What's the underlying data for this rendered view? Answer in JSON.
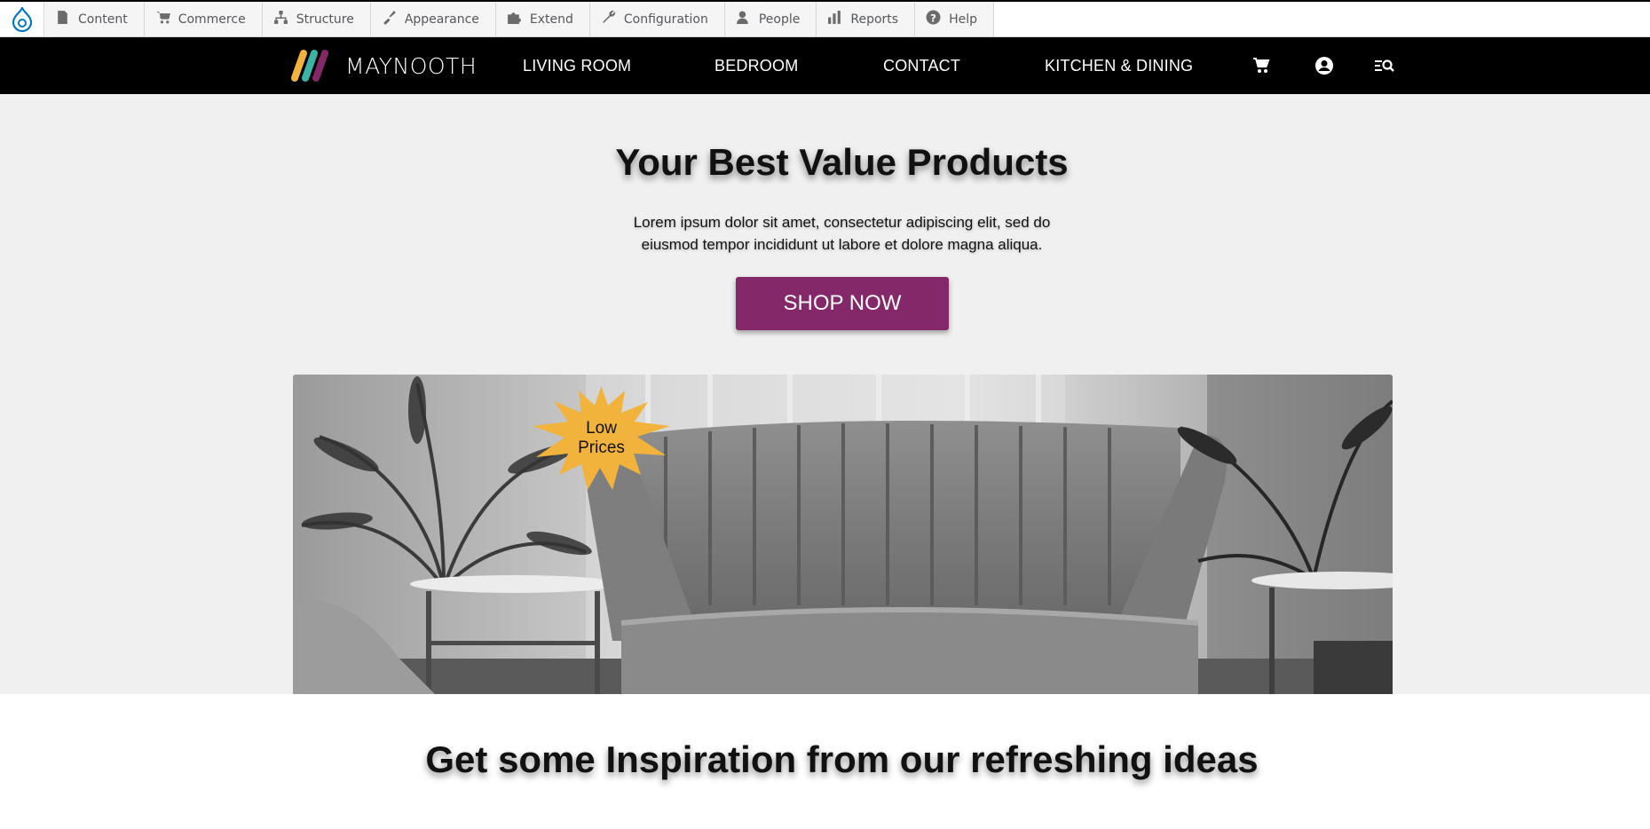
{
  "admin_toolbar": {
    "items": [
      {
        "label": "Content",
        "icon": "document-icon"
      },
      {
        "label": "Commerce",
        "icon": "cart-icon"
      },
      {
        "label": "Structure",
        "icon": "sitemap-icon"
      },
      {
        "label": "Appearance",
        "icon": "paintbrush-icon"
      },
      {
        "label": "Extend",
        "icon": "puzzle-icon"
      },
      {
        "label": "Configuration",
        "icon": "wrench-icon"
      },
      {
        "label": "People",
        "icon": "person-icon"
      },
      {
        "label": "Reports",
        "icon": "bar-chart-icon"
      },
      {
        "label": "Help",
        "icon": "help-icon"
      }
    ]
  },
  "header": {
    "logo_text": "MAYNOOTH",
    "nav": [
      "LIVING ROOM",
      "BEDROOM",
      "CONTACT",
      "KITCHEN & DINING"
    ],
    "icons": [
      "cart-icon",
      "account-icon",
      "search-menu-icon"
    ]
  },
  "hero": {
    "title": "Your Best Value Products",
    "description": "Lorem ipsum dolor sit amet, consectetur adipiscing elit, sed do eiusmod tempor incididunt ut labore et dolore magna aliqua.",
    "button": "SHOP NOW",
    "badge_line1": "Low",
    "badge_line2": "Prices"
  },
  "inspiration": {
    "title": "Get some Inspiration from our refreshing ideas"
  },
  "colors": {
    "brand_purple": "#84286a",
    "badge_yellow": "#f2b33d",
    "drupal_blue": "#0678be"
  }
}
